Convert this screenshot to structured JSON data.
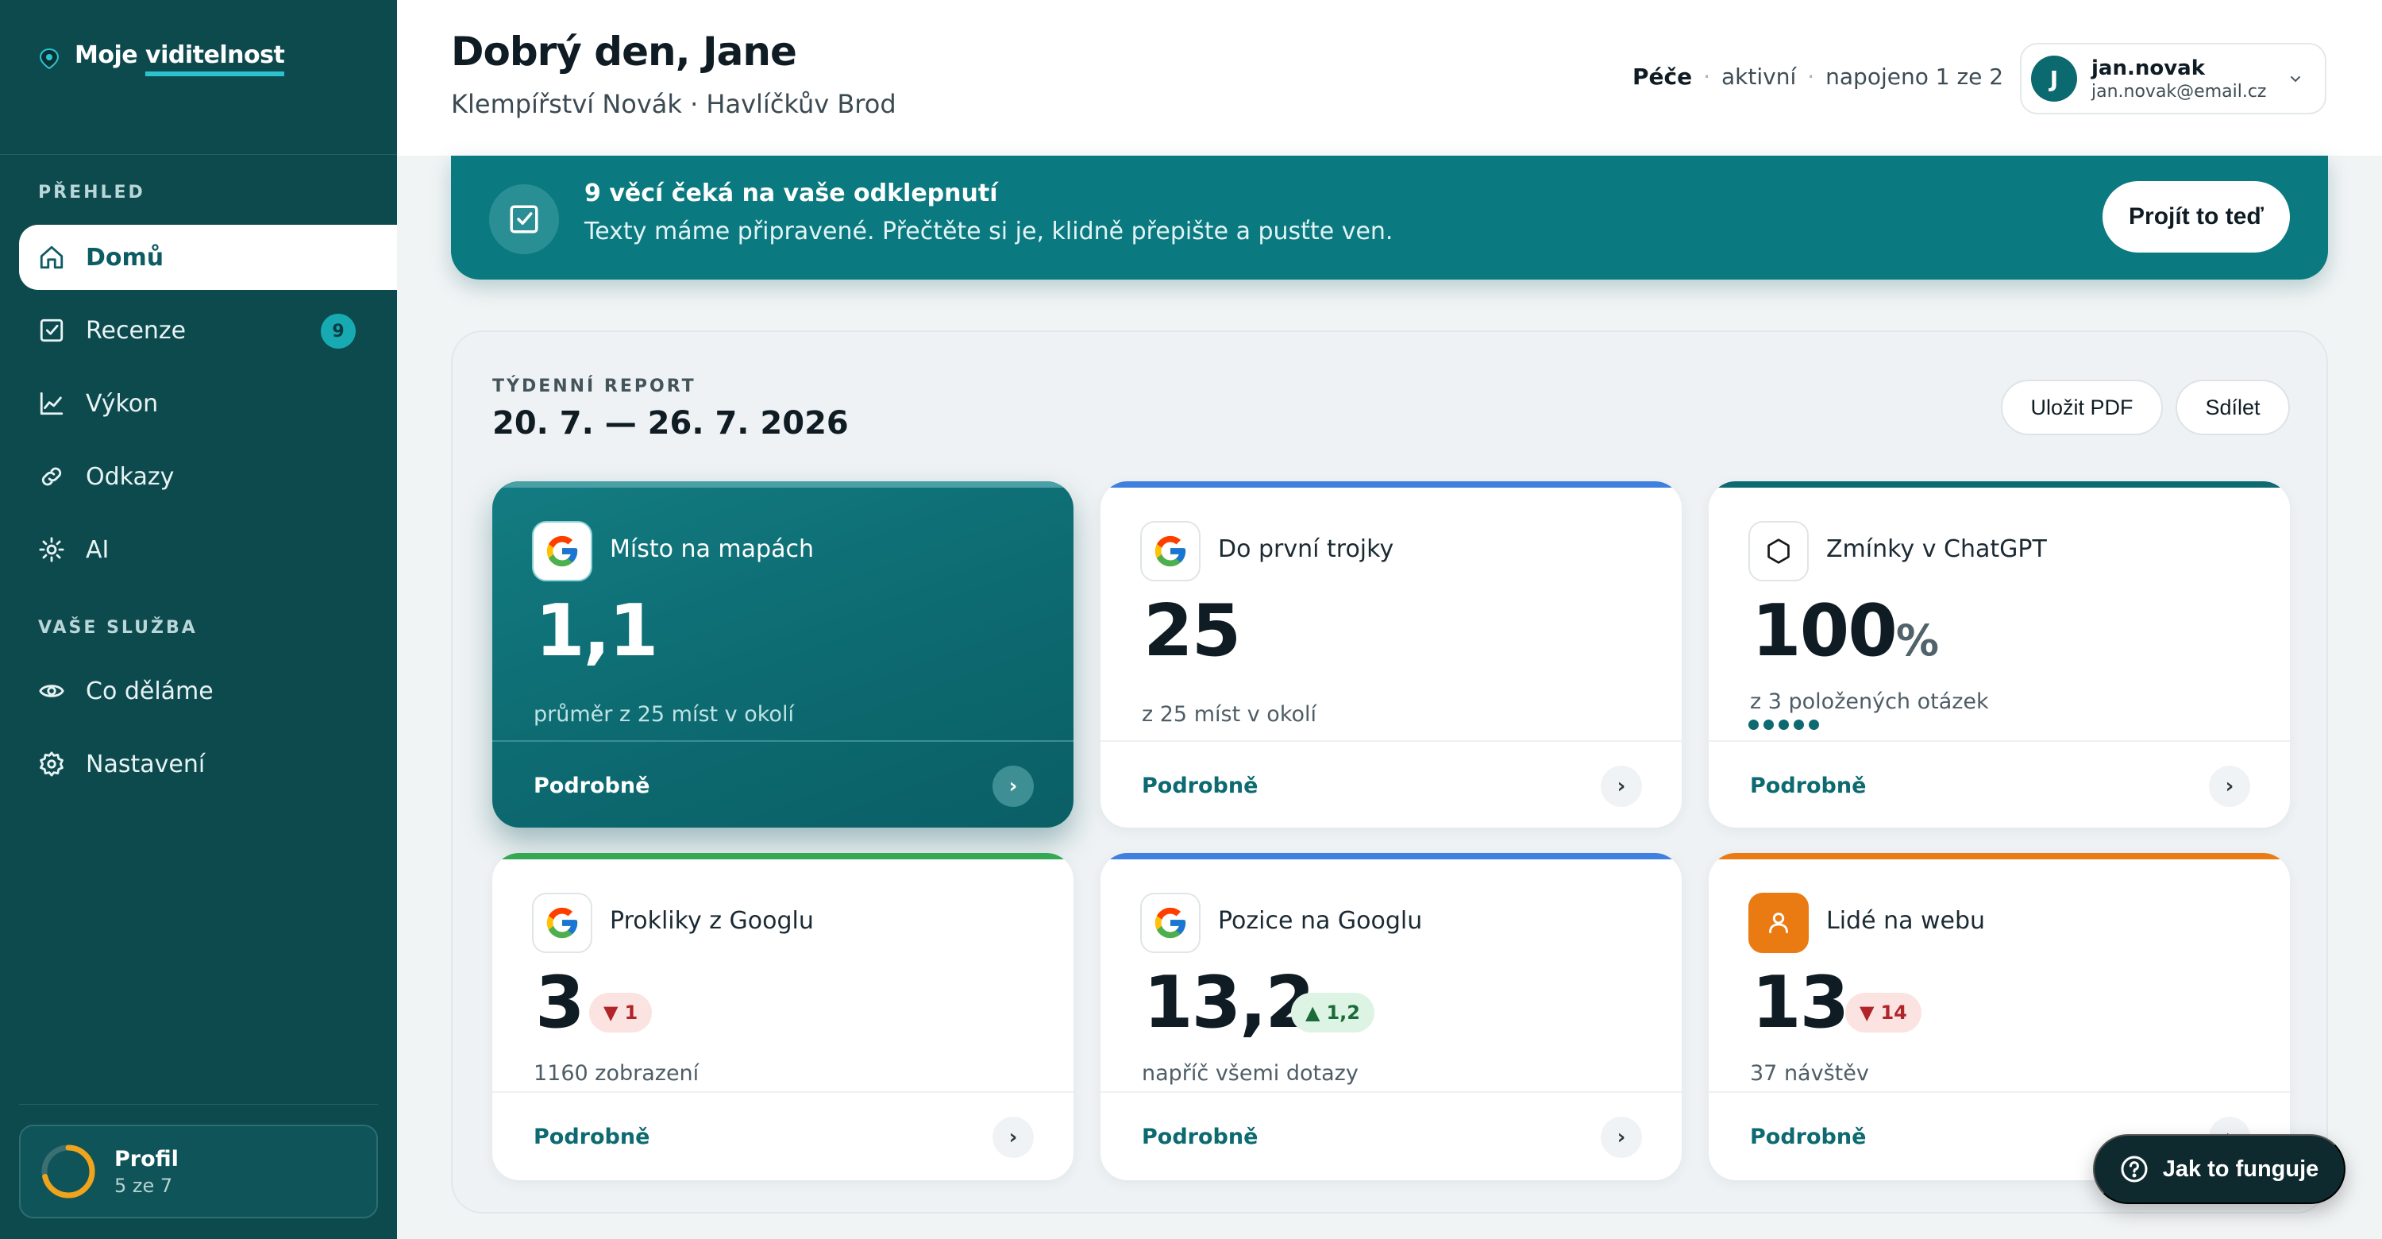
{
  "brand": {
    "name_prefix": "Moje ",
    "name_underlined": "viditelnost"
  },
  "sidebar": {
    "section_overview": "PŘEHLED",
    "section_service": "VAŠE SLUŽBA",
    "items": [
      {
        "label": "Domů",
        "icon": "home-icon",
        "active": true
      },
      {
        "label": "Recenze",
        "icon": "checkbox-icon",
        "badge": "9"
      },
      {
        "label": "Výkon",
        "icon": "chart-line-icon"
      },
      {
        "label": "Odkazy",
        "icon": "link-icon"
      },
      {
        "label": "AI",
        "icon": "sparkle-icon"
      },
      {
        "label": "Co děláme",
        "icon": "eye-icon"
      },
      {
        "label": "Nastavení",
        "icon": "gear-icon"
      }
    ],
    "profile": {
      "title": "Profil",
      "progress_text": "5 ze 7",
      "progress_fraction": 0.714
    }
  },
  "header": {
    "greeting": "Dobrý den, Jane",
    "business": "Klempířství Novák · Havlíčkův Brod",
    "care_label": "Péče",
    "care_status": "aktivní",
    "care_connected": "napojeno 1 ze 2",
    "user": {
      "initial": "J",
      "name": "jan.novak",
      "email": "jan.novak@email.cz"
    }
  },
  "banner": {
    "title": "9 věcí čeká na vaše odklepnutí",
    "subtitle": "Texty máme připravené. Přečtěte si je, klidně přepište a pusťte ven.",
    "button": "Projít to teď"
  },
  "report": {
    "label": "TÝDENNÍ REPORT",
    "range": "20. 7. — 26. 7. 2026",
    "save_pdf": "Uložit PDF",
    "share": "Sdílet",
    "detail_label": "Podrobně",
    "cards": [
      {
        "title": "Místo na mapách",
        "value": "1,1",
        "sub": "průměr z 25 míst v okolí",
        "icon": "google-icon",
        "accent": "#0c6a70"
      },
      {
        "title": "Do první trojky",
        "value": "25",
        "sub": "z 25 míst v okolí",
        "icon": "google-icon",
        "accent": "#3f7fe0"
      },
      {
        "title": "Zmínky v ChatGPT",
        "value": "100",
        "unit": "%",
        "sub": "z 3 položených otázek",
        "icon": "chatgpt-icon",
        "accent": "#0c6a70"
      },
      {
        "title": "Prokliky z Googlu",
        "value": "3",
        "delta": "1",
        "delta_dir": "down",
        "sub": "1160 zobrazení",
        "icon": "google-icon",
        "accent": "#34a853"
      },
      {
        "title": "Pozice na Googlu",
        "value": "13,2",
        "delta": "1,2",
        "delta_dir": "up",
        "sub": "napříč všemi dotazy",
        "icon": "google-icon",
        "accent": "#3f7fe0"
      },
      {
        "title": "Lidé na webu",
        "value": "13",
        "delta": "14",
        "delta_dir": "down",
        "sub": "37 návštěv",
        "icon": "person-icon",
        "accent": "#ea7a12"
      }
    ]
  },
  "help": {
    "label": "Jak to funguje"
  }
}
